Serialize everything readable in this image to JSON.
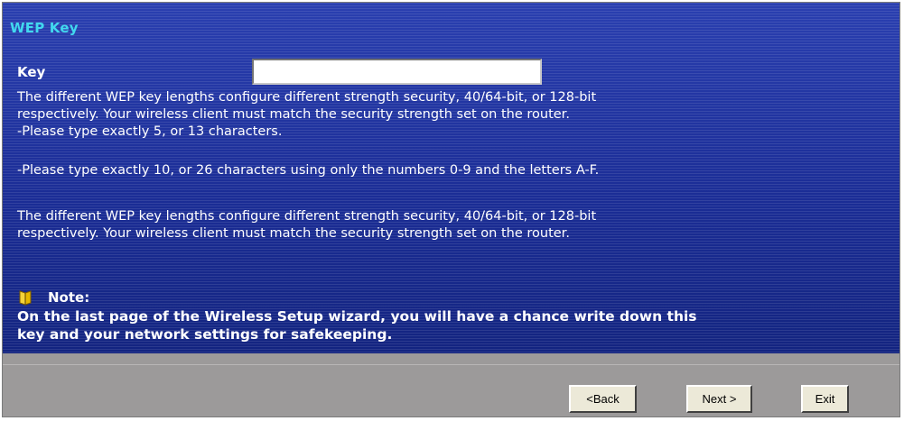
{
  "wizard": {
    "title": "WEP Key",
    "key_label": "Key",
    "key_value": "",
    "paragraphs": [
      "The different WEP key lengths configure different strength security, 40/64-bit, or 128-bit",
      "respectively. Your wireless client must match the security strength set on the router.",
      "-Please type exactly 5, or 13 characters.",
      "-Please type exactly 10, or 26 characters using only the numbers 0-9 and the letters A-F.",
      "The different WEP key lengths configure different strength security, 40/64-bit, or 128-bit",
      "respectively. Your wireless client must match the security strength set on the router."
    ],
    "note": {
      "icon": "note-book-icon",
      "label": "Note:",
      "lines": [
        "On the last page of the Wireless Setup wizard, you will have a chance write down this",
        "key and your network settings for safekeeping."
      ]
    }
  },
  "buttons": {
    "back": "<Back",
    "next": "Next >",
    "exit": "Exit"
  },
  "colors": {
    "panel_blue": "#1d2f9a",
    "title_cyan": "#41d8ef",
    "footer_gray": "#9c9a9a"
  }
}
